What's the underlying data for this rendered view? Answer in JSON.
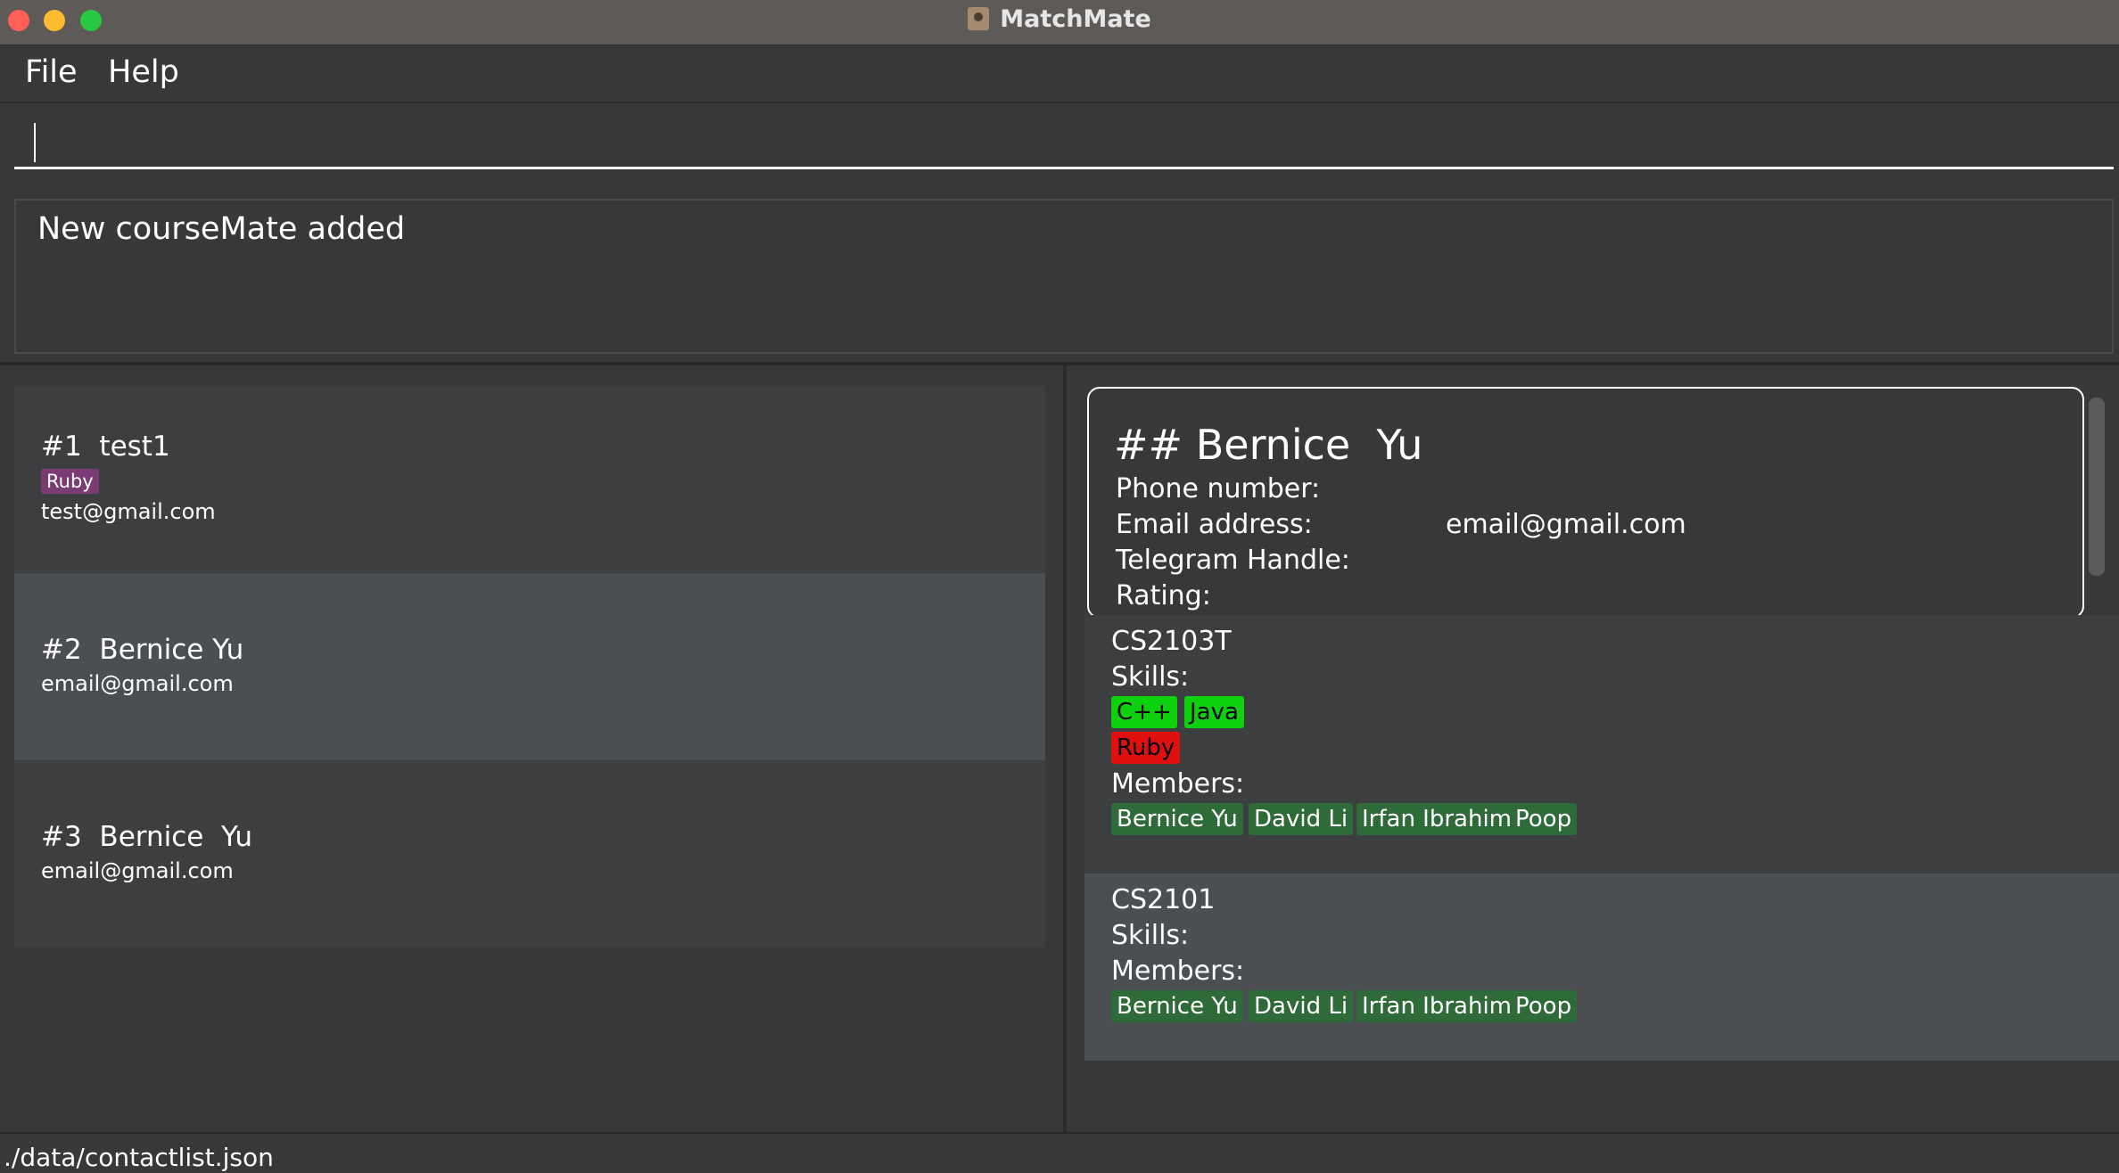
{
  "window": {
    "title": "MatchMate"
  },
  "menu": {
    "file": "File",
    "help": "Help"
  },
  "command": {
    "value": ""
  },
  "result": {
    "message": "New courseMate added"
  },
  "list": {
    "items": [
      {
        "index": "#1",
        "name": "test1",
        "tag": "Ruby",
        "email": "test@gmail.com"
      },
      {
        "index": "#2",
        "name": "Bernice Yu",
        "email": "email@gmail.com"
      },
      {
        "index": "#3",
        "name": "Bernice  Yu",
        "email": "email@gmail.com"
      }
    ]
  },
  "detail": {
    "title": "## Bernice  Yu",
    "phone_label": "Phone number:",
    "email_label": "Email address:",
    "email_value": "email@gmail.com",
    "telegram_label": "Telegram Handle:",
    "rating_label": "Rating:"
  },
  "groups": [
    {
      "name": "CS2103T",
      "skills_label": "Skills:",
      "skills_good": [
        "C++",
        "Java"
      ],
      "skills_bad": [
        "Ruby"
      ],
      "members_label": "Members:",
      "members": [
        "Bernice Yu",
        "David Li",
        "Irfan Ibrahim",
        "Poop"
      ]
    },
    {
      "name": "CS2101",
      "skills_label": "Skills:",
      "members_label": "Members:",
      "members": [
        "Bernice Yu",
        "David Li",
        "Irfan Ibrahim",
        "Poop"
      ]
    }
  ],
  "status": {
    "path": "./data/contactlist.json"
  },
  "colors": {
    "background": "#383838",
    "selected": "#4b4f53",
    "tag_purple": "#7a3a74",
    "skill_good": "#0cd10c",
    "skill_bad": "#e01010",
    "member_chip": "#2f6a39"
  }
}
